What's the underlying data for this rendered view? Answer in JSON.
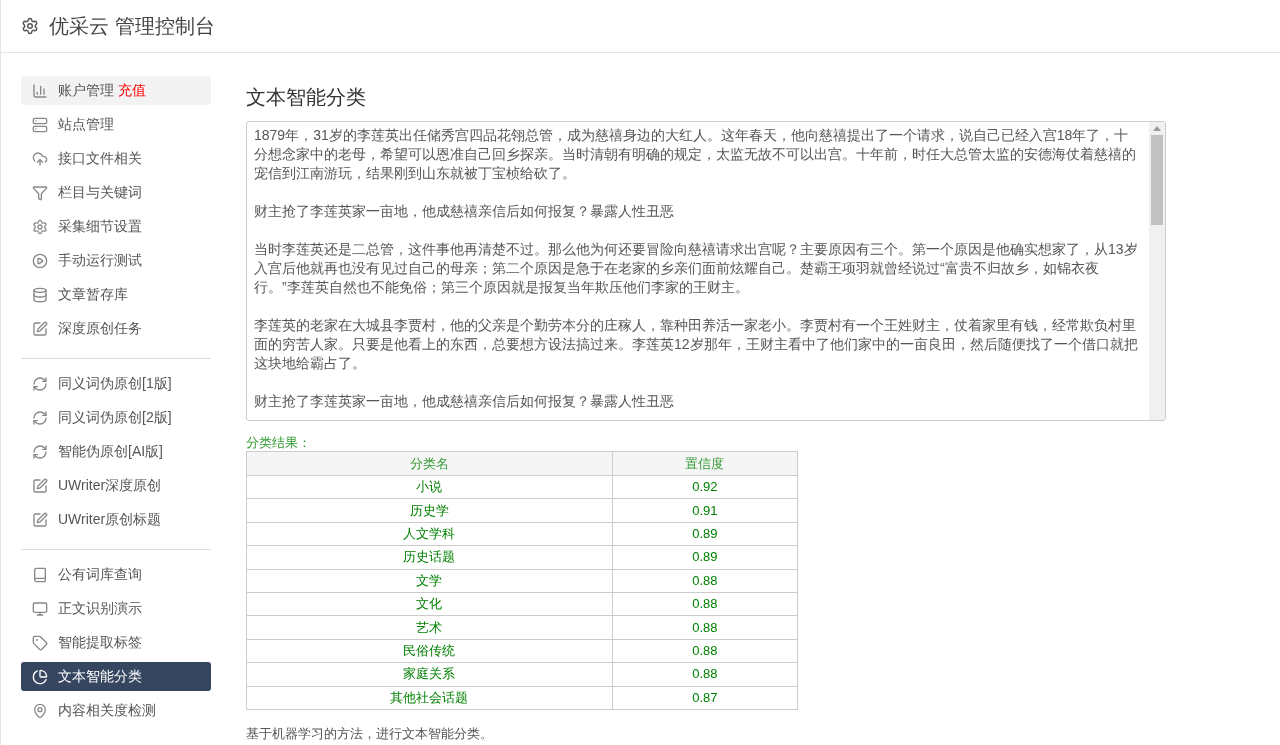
{
  "header": {
    "title": "优采云 管理控制台"
  },
  "sidebar": {
    "groups": [
      [
        {
          "label": "账户管理",
          "badge": "充值",
          "selected": false,
          "hovered": true
        },
        {
          "label": "站点管理",
          "selected": false,
          "hovered": false
        },
        {
          "label": "接口文件相关",
          "selected": false,
          "hovered": false
        },
        {
          "label": "栏目与关键词",
          "selected": false,
          "hovered": false
        },
        {
          "label": "采集细节设置",
          "selected": false,
          "hovered": false
        },
        {
          "label": "手动运行测试",
          "selected": false,
          "hovered": false
        },
        {
          "label": "文章暂存库",
          "selected": false,
          "hovered": false
        },
        {
          "label": "深度原创任务",
          "selected": false,
          "hovered": false
        }
      ],
      [
        {
          "label": "同义词伪原创[1版]",
          "selected": false,
          "hovered": false
        },
        {
          "label": "同义词伪原创[2版]",
          "selected": false,
          "hovered": false
        },
        {
          "label": "智能伪原创[AI版]",
          "selected": false,
          "hovered": false
        },
        {
          "label": "UWriter深度原创",
          "selected": false,
          "hovered": false
        },
        {
          "label": "UWriter原创标题",
          "selected": false,
          "hovered": false
        }
      ],
      [
        {
          "label": "公有词库查询",
          "selected": false,
          "hovered": false
        },
        {
          "label": "正文识别演示",
          "selected": false,
          "hovered": false
        },
        {
          "label": "智能提取标签",
          "selected": false,
          "hovered": false
        },
        {
          "label": "文本智能分类",
          "selected": true,
          "hovered": false
        },
        {
          "label": "内容相关度检测",
          "selected": false,
          "hovered": false
        }
      ]
    ]
  },
  "main": {
    "title": "文本智能分类",
    "text_input": {
      "paragraphs": [
        "1879年，31岁的李莲英出任储秀宫四品花翎总管，成为慈禧身边的大红人。这年春天，他向慈禧提出了一个请求，说自己已经入宫18年了，十分想念家中的老母，希望可以恩准自己回乡探亲。当时清朝有明确的规定，太监无故不可以出宫。十年前，时任大总管太监的安德海仗着慈禧的宠信到江南游玩，结果刚到山东就被丁宝桢给砍了。",
        "财主抢了李莲英家一亩地，他成慈禧亲信后如何报复？暴露人性丑恶",
        "当时李莲英还是二总管，这件事他再清楚不过。那么他为何还要冒险向慈禧请求出宫呢？主要原因有三个。第一个原因是他确实想家了，从13岁入宫后他就再也没有见过自己的母亲；第二个原因是急于在老家的乡亲们面前炫耀自己。楚霸王项羽就曾经说过“富贵不归故乡，如锦衣夜行。”李莲英自然也不能免俗；第三个原因就是报复当年欺压他们李家的王财主。",
        "李莲英的老家在大城县李贾村，他的父亲是个勤劳本分的庄稼人，靠种田养活一家老小。李贾村有一个王姓财主，仗着家里有钱，经常欺负村里面的穷苦人家。只要是他看上的东西，总要想方设法搞过来。李莲英12岁那年，王财主看中了他们家中的一亩良田，然后随便找了一个借口就把这块地给霸占了。",
        "财主抢了李莲英家一亩地，他成慈禧亲信后如何报复？暴露人性丑恶"
      ]
    },
    "result_label": "分类结果：",
    "table": {
      "columns": [
        "分类名",
        "置信度"
      ],
      "rows": [
        [
          "小说",
          "0.92"
        ],
        [
          "历史学",
          "0.91"
        ],
        [
          "人文学科",
          "0.89"
        ],
        [
          "历史话题",
          "0.89"
        ],
        [
          "文学",
          "0.88"
        ],
        [
          "文化",
          "0.88"
        ],
        [
          "艺术",
          "0.88"
        ],
        [
          "民俗传统",
          "0.88"
        ],
        [
          "家庭关系",
          "0.88"
        ],
        [
          "其他社会话题",
          "0.87"
        ]
      ]
    },
    "footer_note": "基于机器学习的方法，进行文本智能分类。"
  }
}
